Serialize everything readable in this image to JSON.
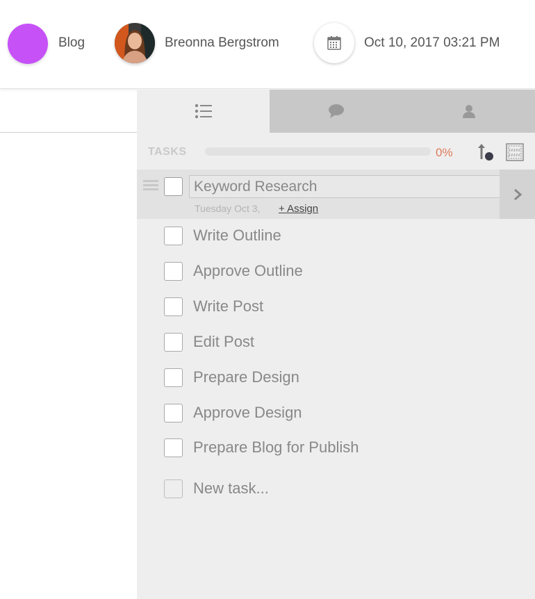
{
  "header": {
    "project_name": "Blog",
    "project_color": "#c652f7",
    "user_name": "Breonna Bergstrom",
    "date_time": "Oct 10, 2017 03:21 PM"
  },
  "panel": {
    "tabs": [
      {
        "name": "tasks",
        "icon": "list-icon",
        "active": true
      },
      {
        "name": "comments",
        "icon": "chat-bubble-icon",
        "active": false
      },
      {
        "name": "people",
        "icon": "person-icon",
        "active": false
      }
    ],
    "tasks_label": "TASKS",
    "progress_value": 0,
    "progress_text": "0%",
    "progress_color": "#e07a5a",
    "selected_task": {
      "title": "Keyword Research",
      "date": "Tuesday Oct 3,",
      "assign_label": "+ Assign"
    },
    "tasks": [
      "Write Outline",
      "Approve Outline",
      "Write Post",
      "Edit Post",
      "Prepare Design",
      "Approve Design",
      "Prepare Blog for Publish"
    ],
    "new_task_placeholder": "New task..."
  }
}
